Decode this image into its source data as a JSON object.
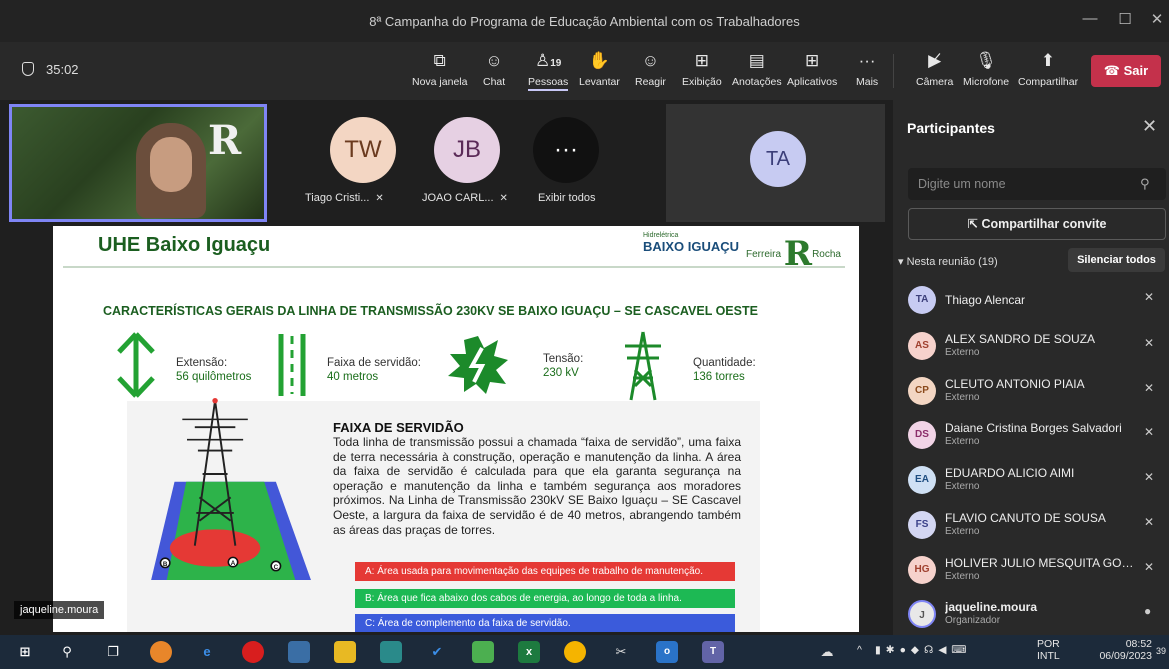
{
  "window": {
    "title": "8ª Campanha do Programa de Educação Ambiental com os Trabalhadores",
    "min_icon": "minimize-icon",
    "max_icon": "maximize-icon",
    "close_icon": "close-icon"
  },
  "toolbar": {
    "timer": "35:02",
    "buttons": [
      {
        "label": "Nova janela",
        "icon": "popout-icon"
      },
      {
        "label": "Chat",
        "icon": "chat-icon"
      },
      {
        "label": "Pessoas",
        "count": "19",
        "icon": "people-icon"
      },
      {
        "label": "Levantar",
        "icon": "raise-hand-icon"
      },
      {
        "label": "Reagir",
        "icon": "react-icon"
      },
      {
        "label": "Exibição",
        "icon": "view-icon"
      },
      {
        "label": "Anotações",
        "icon": "notes-icon"
      },
      {
        "label": "Aplicativos",
        "icon": "apps-icon"
      },
      {
        "label": "Mais",
        "icon": "more-icon"
      },
      {
        "label": "Câmera",
        "icon": "camera-off-icon"
      },
      {
        "label": "Microfone",
        "icon": "mic-off-icon"
      },
      {
        "label": "Compartilhar",
        "icon": "share-icon"
      }
    ],
    "leave": "Sair"
  },
  "stage": {
    "tiles": [
      {
        "initials": "TW",
        "name": "Tiago Cristi...",
        "color": "#f3d6c3",
        "text": "#6b3b1f"
      },
      {
        "initials": "JB",
        "name": "JOAO CARL...",
        "color": "#e6d0e3",
        "text": "#5b2b58"
      },
      {
        "initials": "···",
        "name": "Exibir todos",
        "color": "#111111",
        "text": "#ffffff"
      }
    ],
    "ta": {
      "initials": "TA"
    },
    "self_name": "jaqueline.moura"
  },
  "slide": {
    "title": "UHE Baixo Iguaçu",
    "logo_main": "BAIXO IGUAÇU",
    "logo_small": "Hidrelétrica",
    "logo_second": "Ferreira",
    "logo_second_b": "Rocha",
    "subtitle": "CARACTERÍSTICAS GERAIS DA LINHA DE TRANSMISSÃO 230KV SE BAIXO IGUAÇU – SE CASCAVEL OESTE",
    "stats": [
      {
        "label": "Extensão:",
        "value": "56 quilômetros"
      },
      {
        "label": "Faixa de servidão:",
        "value": "40 metros"
      },
      {
        "label": "Tensão:",
        "value": "230 kV"
      },
      {
        "label": "Quantidade:",
        "value": "136 torres"
      }
    ],
    "box_title": "FAIXA DE SERVIDÃO",
    "box_text": "Toda linha de transmissão possui a chamada “faixa de servidão”, uma faixa de terra necessária à construção, operação e manutenção da linha. A área da faixa de servidão é calculada para que ela garanta segurança na operação e manutenção da linha e também segurança aos moradores próximos. Na Linha de Transmissão 230kV SE Baixo Iguaçu – SE Cascavel Oeste, a largura da faixa de servidão é de 40 metros, abrangendo também as áreas das praças de torres.",
    "legend": [
      {
        "text": "A: Área usada para movimentação das equipes de trabalho de manutenção.",
        "color": "#e53935"
      },
      {
        "text": "B: Área que fica abaixo dos cabos de energia, ao longo de toda a linha.",
        "color": "#1db954"
      },
      {
        "text": "C: Área de complemento da faixa de servidão.",
        "color": "#3b5bdb"
      }
    ],
    "markers": [
      "A",
      "B",
      "C"
    ]
  },
  "panel": {
    "title": "Participantes",
    "search_placeholder": "Digite um nome",
    "invite": "Compartilhar convite",
    "section": "Nesta reunião (19)",
    "mute_all": "Silenciar todos",
    "people": [
      {
        "initials": "TA",
        "name": "Thiago Alencar",
        "role": "",
        "color": "#c7cbf2",
        "text": "#3c3f7a"
      },
      {
        "initials": "AS",
        "name": "ALEX SANDRO DE SOUZA",
        "role": "Externo",
        "color": "#f6d2cc",
        "text": "#a0412f"
      },
      {
        "initials": "CP",
        "name": "CLEUTO ANTONIO PIAIA",
        "role": "Externo",
        "color": "#f3d6c3",
        "text": "#8a4a1c"
      },
      {
        "initials": "DS",
        "name": "Daiane Cristina Borges Salvadori",
        "role": "Externo",
        "color": "#f1d3e6",
        "text": "#8b2c6a"
      },
      {
        "initials": "EA",
        "name": "EDUARDO ALICIO AIMI",
        "role": "Externo",
        "color": "#cfe0f4",
        "text": "#1e4d80"
      },
      {
        "initials": "FS",
        "name": "FLAVIO CANUTO DE SOUSA",
        "role": "Externo",
        "color": "#d3d6f2",
        "text": "#3b4189"
      },
      {
        "initials": "HG",
        "name": "HOLIVER JULIO MESQUITA GON...",
        "role": "Externo",
        "color": "#f6d2cc",
        "text": "#a0412f"
      },
      {
        "initials": "J",
        "name": "jaqueline.moura",
        "role": "Organizador",
        "color": "#e8e8e8",
        "text": "#555"
      }
    ]
  },
  "taskbar": {
    "lang": "POR",
    "layout": "INTL",
    "time": "08:52",
    "date": "06/09/2023",
    "notif": "39"
  }
}
